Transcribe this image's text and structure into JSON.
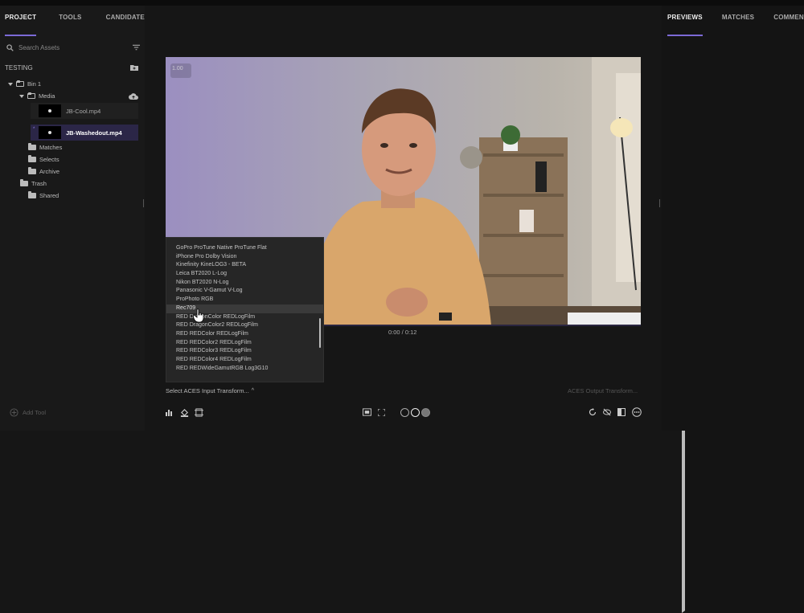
{
  "left_tabs": [
    "PROJECT",
    "TOOLS",
    "CANDIDATES"
  ],
  "right_tabs": [
    "PREVIEWS",
    "MATCHES",
    "COMMENTS"
  ],
  "search": {
    "placeholder": "Search Assets"
  },
  "project": {
    "name": "TESTING",
    "bin": "Bin 1",
    "media_folder": "Media",
    "clips": [
      "JB-Cool.mp4",
      "JB-Washedout.mp4"
    ],
    "folders": [
      "Matches",
      "Selects",
      "Archive",
      "Trash",
      "Shared"
    ]
  },
  "viewer": {
    "zoom_badge": "1.00",
    "timecode": "0:00 / 0:12"
  },
  "dropdown_options": [
    "GoPro ProTune Native ProTune Flat",
    "iPhone Pro Dolby Vision",
    "Kinefinity KineLOG3 - BETA",
    "Leica BT2020 L-Log",
    "Nikon BT2020 N-Log",
    "Panasonic V-Gamut V-Log",
    "ProPhoto RGB",
    "Rec709",
    "RED DragonColor REDLogFilm",
    "RED DragonColor2 REDLogFilm",
    "RED REDColor REDLogFilm",
    "RED REDColor2 REDLogFilm",
    "RED REDColor3 REDLogFilm",
    "RED REDColor4 REDLogFilm",
    "RED REDWideGamutRGB Log3G10"
  ],
  "dropdown_highlighted": "Rec709",
  "bottom": {
    "input_transform": "Select ACES Input Transform...",
    "output_transform": "ACES Output Transform...",
    "add_tool": "Add Tool"
  },
  "colors": {
    "accent": "#7c6ad6",
    "selected_clip_bg": "#2b2647"
  }
}
